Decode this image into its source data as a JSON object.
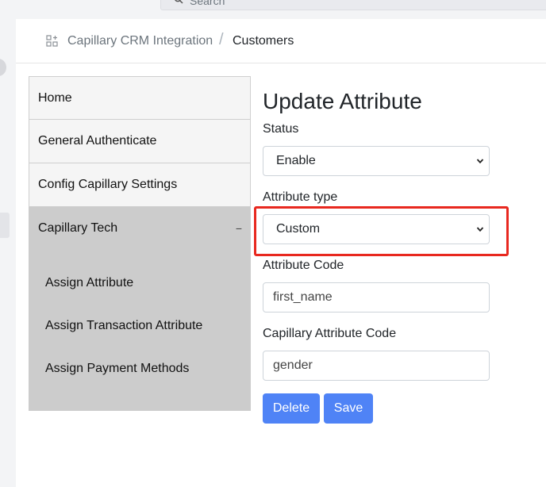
{
  "search": {
    "placeholder": "Search"
  },
  "breadcrumb": {
    "root": "Capillary CRM Integration",
    "separator": "/",
    "current": "Customers"
  },
  "menu": {
    "items": [
      {
        "label": "Home"
      },
      {
        "label": "General Authenticate"
      },
      {
        "label": "Config Capillary Settings"
      },
      {
        "label": "Capillary Tech",
        "expanded_indicator": "−"
      }
    ],
    "submenu": [
      {
        "label": "Assign Attribute"
      },
      {
        "label": "Assign Transaction Attribute"
      },
      {
        "label": "Assign Payment Methods"
      }
    ]
  },
  "form": {
    "title": "Update Attribute",
    "status": {
      "label": "Status",
      "value": "Enable"
    },
    "attribute_type": {
      "label": "Attribute type",
      "value": "Custom"
    },
    "attribute_code": {
      "label": "Attribute Code",
      "value": "first_name"
    },
    "capillary_attribute_code": {
      "label": "Capillary Attribute Code",
      "value": "gender"
    },
    "delete_label": "Delete",
    "save_label": "Save"
  },
  "colors": {
    "primary_button": "#4f83f6",
    "highlight": "#e8281f",
    "menu_expanded": "#cccccc"
  },
  "icons": {
    "search": "search-icon",
    "breadcrumb": "apps-icon",
    "select": "chevron-down-icon"
  }
}
